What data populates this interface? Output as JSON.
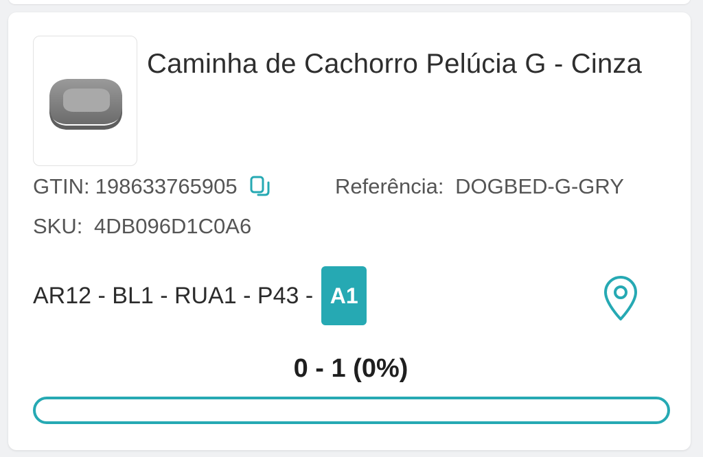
{
  "product": {
    "title": "Caminha de Cachorro Pelúcia G - Cinza",
    "gtin_label": "GTIN:",
    "gtin_value": "198633765905",
    "reference_label": "Referência:",
    "reference_value": "DOGBED-G-GRY",
    "sku_label": "SKU:",
    "sku_value": "4DB096D1C0A6",
    "image_icon": "dog-bed-image"
  },
  "location": {
    "path": "AR12 - BL1 - RUA1 - P43 -",
    "slot": "A1",
    "icon": "map-pin-icon"
  },
  "progress": {
    "label": "0 - 1 (0%)",
    "done": 0,
    "total": 1,
    "fraction": 0
  },
  "colors": {
    "accent": "#26a9b3",
    "background": "#f0f1f3",
    "card": "#ffffff"
  }
}
